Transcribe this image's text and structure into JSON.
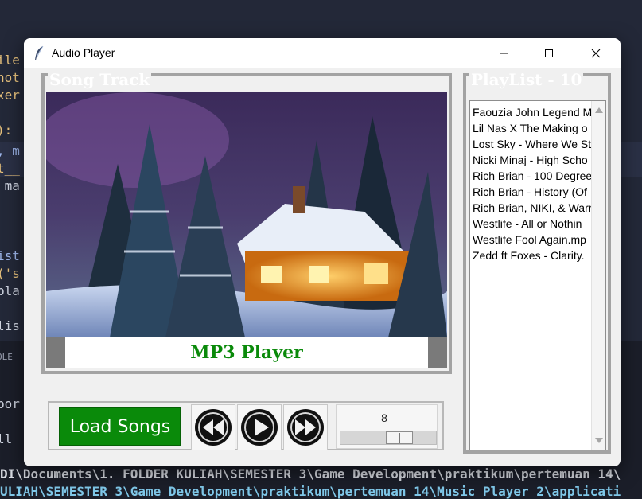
{
  "window": {
    "title": "Audio Player"
  },
  "song_track": {
    "title": "Song Track",
    "caption": "MP3 Player"
  },
  "controls": {
    "load_label": "Load Songs",
    "volume_value": "8",
    "volume_fraction": 0.66
  },
  "playlist": {
    "title": "PlayList - 10",
    "items": [
      "Faouzia John Legend M",
      "Lil Nas X The Making o",
      "Lost Sky - Where We St",
      "Nicki Minaj - High Scho",
      "Rich Brian - 100 Degree",
      "Rich Brian - History (Of",
      "Rich Brian, NIKI, & Warr",
      "Westlife - All or Nothin",
      "Westlife Fool Again.mp",
      "Zedd ft Foxes - Clarity."
    ]
  },
  "background": {
    "code_lines": [
      "ile",
      "hot",
      "xer",
      "):",
      ", m",
      "t__",
      " ma",
      "ist",
      "('s",
      "pla",
      "lis",
      "OLE",
      "por",
      "ll"
    ],
    "terminal_line_1": "DI\\Documents\\1. FOLDER KULIAH\\SEMESTER 3\\Game Development\\praktikum\\pertemuan 14\\",
    "terminal_line_2": "ULIAH\\SEMESTER 3\\Game Development\\praktikum\\pertemuan 14\\Music Player 2\\applicati"
  },
  "colors": {
    "accent_green": "#0a8a0a",
    "frame_gray": "#a3a3a3",
    "window_bg": "#f0f0f0"
  }
}
